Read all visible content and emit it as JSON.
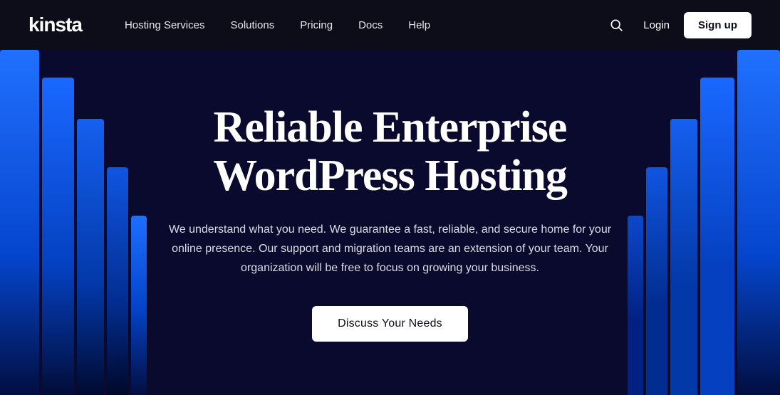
{
  "nav": {
    "logo": "kinsta",
    "links": [
      {
        "label": "Hosting Services",
        "id": "hosting-services"
      },
      {
        "label": "Solutions",
        "id": "solutions"
      },
      {
        "label": "Pricing",
        "id": "pricing"
      },
      {
        "label": "Docs",
        "id": "docs"
      },
      {
        "label": "Help",
        "id": "help"
      }
    ],
    "login_label": "Login",
    "signup_label": "Sign up"
  },
  "hero": {
    "title_line1": "Reliable Enterprise",
    "title_line2": "WordPress Hosting",
    "subtitle": "We understand what you need. We guarantee a fast, reliable, and secure home for your online presence. Our support and migration teams are an extension of your team. Your organization will be free to focus on growing your business.",
    "cta_label": "Discuss Your Needs"
  },
  "colors": {
    "nav_bg": "#0d0d1a",
    "hero_bg": "#0a0a2e",
    "accent_blue": "#1a6bff",
    "white": "#ffffff"
  }
}
